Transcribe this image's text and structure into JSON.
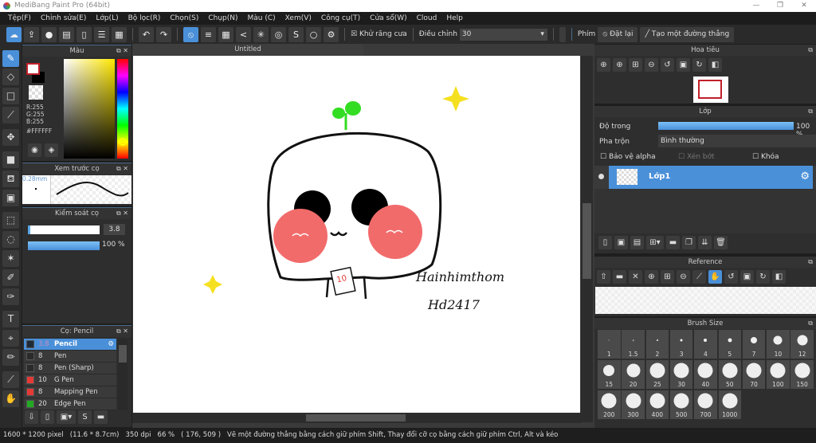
{
  "window": {
    "title": "MediBang Paint Pro (64bit)",
    "minimize": "—",
    "restore": "❐",
    "close": "✕"
  },
  "menu": [
    "Tệp(F)",
    "Chỉnh sửa(E)",
    "Lớp(L)",
    "Bộ lọc(R)",
    "Chọn(S)",
    "Chụp(N)",
    "Màu (C)",
    "Xem(V)",
    "Công cụ(T)",
    "Cửa sổ(W)",
    "Cloud",
    "Help"
  ],
  "toolbar": {
    "antialias_label": "Khử răng cưa",
    "antialias_checked": true,
    "adjust_label": "Điều chỉnh",
    "adjust_value": "30",
    "key_label": "Phím",
    "reset_label": "Đặt lại",
    "straight_line_label": "Tạo một đường thẳng"
  },
  "color_panel": {
    "title": "Màu",
    "r": "R:255",
    "g": "G:255",
    "b": "B:255",
    "hex": "#FFFFFF",
    "foreground": "#FFFFFF",
    "background": "#000000"
  },
  "brush_preview": {
    "title": "Xem trước cọ",
    "size": "0.28mm"
  },
  "brush_control": {
    "title": "Kiểm soát cọ",
    "size": "3.8",
    "opacity": "100 %",
    "opacity_value": 100
  },
  "brush_list": {
    "title": "Cọ: Pencil",
    "items": [
      {
        "size": "3.8",
        "name": "Pencil",
        "color": "#1e2a36",
        "selected": true
      },
      {
        "size": "8",
        "name": "Pen",
        "color": "#2a2a2a"
      },
      {
        "size": "8",
        "name": "Pen (Sharp)",
        "color": "#2a2a2a"
      },
      {
        "size": "10",
        "name": "G Pen",
        "color": "#e53935"
      },
      {
        "size": "8",
        "name": "Mapping Pen",
        "color": "#e53935"
      },
      {
        "size": "20",
        "name": "Edge Pen",
        "color": "#22aa22"
      }
    ]
  },
  "canvas": {
    "tab": "Untitled",
    "signature_line1": "Hainhimthom",
    "signature_line2": "Hd2417",
    "badge_text": "10"
  },
  "navigator": {
    "title": "Hoa tiêu"
  },
  "layer_panel": {
    "title": "Lớp",
    "opacity_label": "Độ trong",
    "opacity": "100 %",
    "opacity_value": 100,
    "blend_label": "Pha trộn",
    "blend_value": "Bình thường",
    "protect_alpha": "Bảo vệ alpha",
    "clipping": "Xén bớt",
    "lock": "Khóa",
    "layers": [
      {
        "name": "Lớp1",
        "selected": true
      }
    ]
  },
  "reference": {
    "title": "Reference"
  },
  "brush_size": {
    "title": "Brush Size",
    "sizes": [
      "1",
      "1.5",
      "2",
      "3",
      "4",
      "5",
      "7",
      "10",
      "12",
      "15",
      "20",
      "25",
      "30",
      "40",
      "50",
      "70",
      "100",
      "150",
      "200",
      "300",
      "400",
      "500",
      "700",
      "1000"
    ]
  },
  "status": {
    "dimensions": "1600 * 1200 pixel",
    "physical": "(11.6 * 8.7cm)",
    "dpi": "350 dpi",
    "zoom": "66 %",
    "cursor": "( 176, 509 )",
    "hint": "Vẽ một đường thẳng bằng cách giữ phím Shift, Thay đổi cỡ cọ bằng cách giữ phím Ctrl, Alt và kéo"
  },
  "colors": {
    "accent": "#4a90d9",
    "panel": "#2e2e2e",
    "cheek": "#f26b6b",
    "sprout": "#33dd22",
    "star": "#f5e020"
  }
}
